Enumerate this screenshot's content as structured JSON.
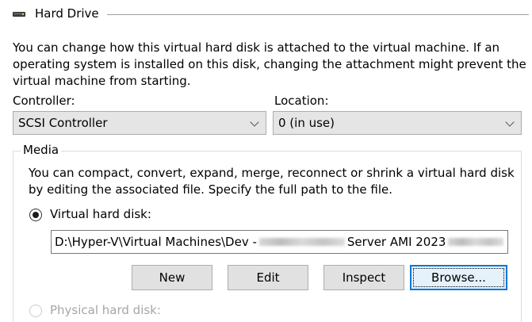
{
  "section": {
    "title": "Hard Drive",
    "icon": "hard-drive-icon"
  },
  "intro_text_lines": [
    "You can change how this virtual hard disk is attached to the virtual machine. If an",
    "operating system is installed on this disk, changing the attachment might prevent the",
    "virtual machine from starting."
  ],
  "controller": {
    "label": "Controller:",
    "selected": "SCSI Controller"
  },
  "location": {
    "label": "Location:",
    "selected": "0 (in use)"
  },
  "media": {
    "title": "Media",
    "text_lines": [
      "You can compact, convert, expand, merge, reconnect or shrink a virtual hard disk",
      "by editing the associated file. Specify the full path to the file."
    ],
    "virtual_hard_disk": {
      "label": "Virtual hard disk:",
      "checked": true,
      "path_prefix": "D:\\Hyper-V\\Virtual Machines\\Dev -",
      "path_middle": "Server AMI 2023"
    },
    "physical_hard_disk": {
      "label": "Physical hard disk:",
      "checked": false,
      "enabled": false
    },
    "buttons": {
      "new": "New",
      "edit": "Edit",
      "inspect": "Inspect",
      "browse": "Browse..."
    }
  },
  "colors": {
    "focus_accent": "#0078d7",
    "disabled_text": "#a6a6a6"
  }
}
